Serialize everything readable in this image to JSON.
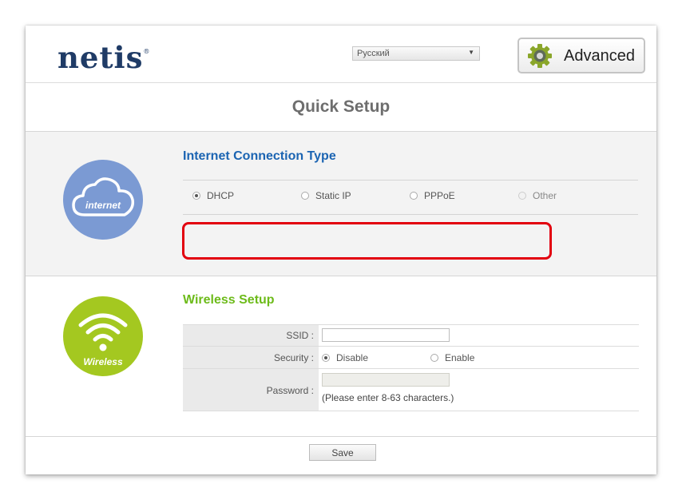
{
  "header": {
    "logo_text": "netis",
    "logo_mark": "®",
    "language_selected": "Русский",
    "advanced_label": "Advanced"
  },
  "page_title": "Quick Setup",
  "internet": {
    "icon_caption": "internet",
    "title": "Internet Connection Type",
    "options": [
      "DHCP",
      "Static IP",
      "PPPoE",
      "Other"
    ],
    "selected": "DHCP",
    "disabled": [
      "Other"
    ]
  },
  "wireless": {
    "icon_caption": "Wireless",
    "title": "Wireless Setup",
    "ssid_label": "SSID :",
    "ssid_value": "",
    "security_label": "Security :",
    "security_options": [
      "Disable",
      "Enable"
    ],
    "security_selected": "Disable",
    "password_label": "Password :",
    "password_value": "",
    "password_hint": "(Please enter 8-63 characters.)"
  },
  "footer": {
    "save_label": "Save"
  },
  "colors": {
    "brand": "#1f3b66",
    "internet_circle": "#7b9ad3",
    "wireless_circle": "#a4c820",
    "internet_title": "#1b64b2",
    "wireless_title": "#6dbb1a",
    "highlight": "#e2000f"
  }
}
